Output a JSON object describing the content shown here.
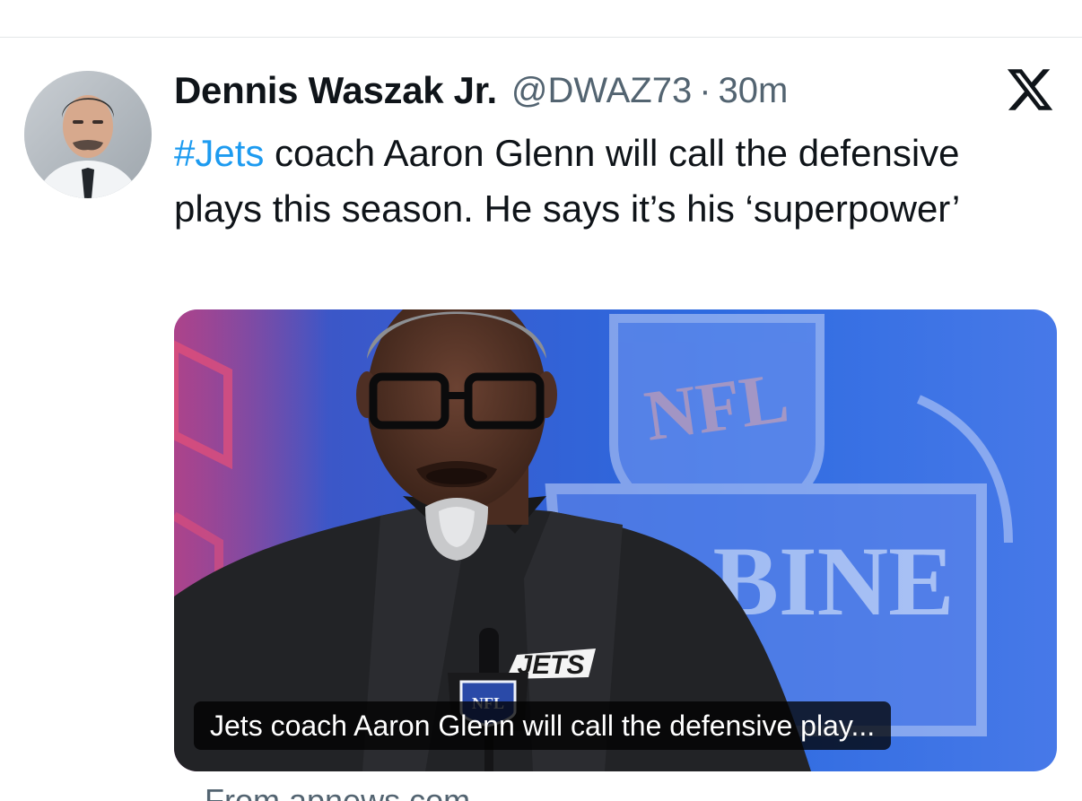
{
  "tweet": {
    "author_name": "Dennis Waszak Jr.",
    "handle": "@DWAZ73",
    "separator": "·",
    "time": "30m",
    "hashtag": "#Jets",
    "text_after_hashtag": " coach Aaron Glenn will call the defensive plays this season. He says it’s his ‘superpower’"
  },
  "media": {
    "caption": "Jets coach Aaron Glenn will call the defensive play...",
    "logo_text": "NFL",
    "banner_text": "BINE",
    "jersey_text": "JETS",
    "mic_text": "NFL"
  },
  "source": {
    "text": "From apnews.com"
  },
  "icons": {
    "platform": "x-logo-icon"
  },
  "colors": {
    "link": "#1d9bf0",
    "text_primary": "#0f1419",
    "text_secondary": "#536471"
  }
}
